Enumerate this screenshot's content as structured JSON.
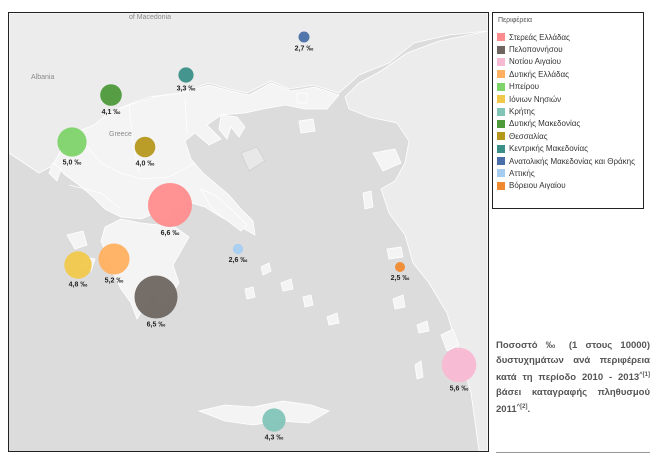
{
  "legend": {
    "title": "Περιφέρεια",
    "items": [
      {
        "label": "Στερεάς Ελλάδας",
        "color": "#ff8c8c"
      },
      {
        "label": "Πελοποννήσου",
        "color": "#6e6560"
      },
      {
        "label": "Νοτίου Αιγαίου",
        "color": "#f8b9d2"
      },
      {
        "label": "Δυτικής Ελλάδας",
        "color": "#ffb060"
      },
      {
        "label": "Ηπείρου",
        "color": "#7ed36a"
      },
      {
        "label": "Ιόνιων Νησιών",
        "color": "#f0c84a"
      },
      {
        "label": "Κρήτης",
        "color": "#82c4b8"
      },
      {
        "label": "Δυτικής Μακεδονίας",
        "color": "#4e9a3a"
      },
      {
        "label": "Θεσσαλίας",
        "color": "#b5981c"
      },
      {
        "label": "Κεντρικής Μακεδονίας",
        "color": "#3a9088"
      },
      {
        "label": "Ανατολικής Μακεδονίας και Θράκης",
        "color": "#4a6fa8"
      },
      {
        "label": "Αττικής",
        "color": "#a6cdf0"
      },
      {
        "label": "Βόρειου Αιγαίου",
        "color": "#f08a30"
      }
    ]
  },
  "map_places": {
    "macedonia": "of Macedonia",
    "albania": "Albania",
    "greece": "Greece"
  },
  "bubbles": [
    {
      "region": "Στερεάς Ελλάδας",
      "value": 6.6,
      "label": "6,6 ‰"
    },
    {
      "region": "Πελοποννήσου",
      "value": 6.5,
      "label": "6,5 ‰"
    },
    {
      "region": "Νοτίου Αιγαίου",
      "value": 5.6,
      "label": "5,6 ‰"
    },
    {
      "region": "Δυτικής Ελλάδας",
      "value": 5.2,
      "label": "5,2 ‰"
    },
    {
      "region": "Ηπείρου",
      "value": 5.0,
      "label": "5,0 ‰"
    },
    {
      "region": "Ιόνιων Νησιών",
      "value": 4.8,
      "label": "4,8 ‰"
    },
    {
      "region": "Κρήτης",
      "value": 4.3,
      "label": "4,3 ‰"
    },
    {
      "region": "Δυτικής Μακεδονίας",
      "value": 4.1,
      "label": "4,1 ‰"
    },
    {
      "region": "Θεσσαλίας",
      "value": 4.0,
      "label": "4,0 ‰"
    },
    {
      "region": "Κεντρικής Μακεδονίας",
      "value": 3.3,
      "label": "3,3 ‰"
    },
    {
      "region": "Ανατολικής Μακεδονίας και Θράκης",
      "value": 2.7,
      "label": "2,7 ‰"
    },
    {
      "region": "Αττικής",
      "value": 2.6,
      "label": "2,6 ‰"
    },
    {
      "region": "Βόρειου Αιγαίου",
      "value": 2.5,
      "label": "2,5 ‰"
    }
  ],
  "caption": {
    "text": "Ποσοστό ‰ (1 στους 10000) δυστυχημάτων ανά περιφέρεια κατά τη περίοδο 2010 - 2013",
    "sup1": "^[1]",
    "middle": " βάσει καταγραφής πληθυσμού 2011",
    "sup2": "^[2]",
    "end": "."
  }
}
